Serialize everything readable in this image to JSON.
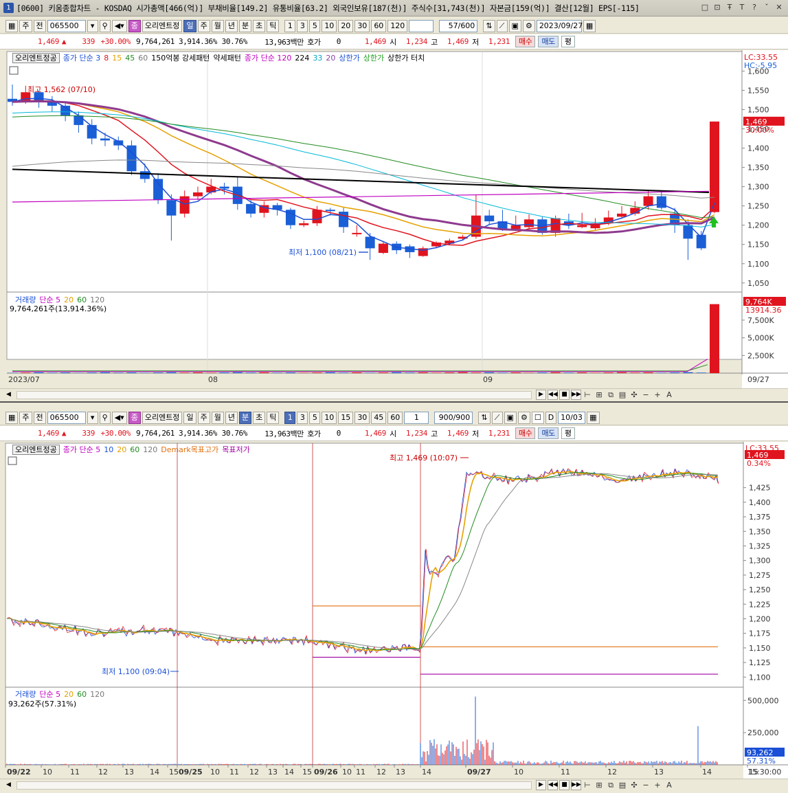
{
  "window": {
    "title": "[0600] 키움종합차트 - KOSDAQ 시가총액[466(억)] 부채비율[149.2] 유통비율[63.2] 외국인보유[187(천)] 주식수[31,743(천)] 자본금[159(억)] 결산[12월] EPS[-115]",
    "icon": "1",
    "buttons": [
      "□",
      "⊡",
      "Ŧ",
      "T",
      "?",
      "ˇ",
      "✕"
    ]
  },
  "daily": {
    "toolbar": {
      "type": "주",
      "prev": "전",
      "code": "065500",
      "search_icon": "magnifier",
      "jong_label": "종",
      "orient_label": "오리엔트정",
      "periods": [
        "일",
        "주",
        "월",
        "년",
        "분",
        "초",
        "틱"
      ],
      "numbers": [
        "1",
        "3",
        "5",
        "10",
        "20",
        "30",
        "60",
        "120"
      ],
      "count": "57/600",
      "date": "2023/09/27"
    },
    "quote": {
      "price": "1,469",
      "change": "339",
      "rate": "+30.00%",
      "volume": "9,764,261",
      "vol_rate": "3,914.36%",
      "turnover": "30.76%",
      "amount": "13,963백만",
      "hoga_label": "호가",
      "hoga_val": "0",
      "ask": "1,469",
      "open_label": "시",
      "open": "1,234",
      "high_label": "고",
      "high": "1,469",
      "low_label": "저",
      "low": "1,231",
      "buy": "매수",
      "sell": "매도",
      "pyeong": "평"
    },
    "legend": [
      "오리엔트정공",
      "종가 단순 3",
      "8",
      "15",
      "45",
      "60",
      "150억봉 강세패턴",
      "약세패턴",
      "종가 단순 120",
      "224",
      "33",
      "20",
      "상한가",
      "상한가",
      "상한가 터치"
    ],
    "price_axis": [
      "1,600",
      "1,550",
      "1,500",
      "1,450",
      "1,400",
      "1,350",
      "1,300",
      "1,250",
      "1,200",
      "1,150",
      "1,100",
      "1,050"
    ],
    "lc": "LC:33.55",
    "hc": "HC:-5.95",
    "current_tag": "1,469",
    "current_pct": "30.00%",
    "high_note": "최고 1,562 (07/10)",
    "low_note": "최저 1,100 (08/21)",
    "vol_legend": [
      "거래량",
      "단순 5",
      "20",
      "60",
      "120"
    ],
    "vol_info": "9,764,261주(13,914.36%)",
    "vol_axis": [
      "7,500K",
      "5,000K",
      "2,500K"
    ],
    "vol_tag": "9,764K",
    "vol_tag2": "13914.36",
    "date_axis": [
      "2023/07",
      "08",
      "09",
      "09/27"
    ]
  },
  "minute": {
    "toolbar": {
      "type": "주",
      "prev": "전",
      "code": "065500",
      "jong_label": "종",
      "orient_label": "오리엔트정",
      "periods": [
        "일",
        "주",
        "월",
        "년",
        "분",
        "초",
        "틱"
      ],
      "numbers": [
        "1",
        "3",
        "5",
        "10",
        "15",
        "30",
        "45",
        "60"
      ],
      "unit": "1",
      "count": "900/900",
      "d_label": "D",
      "date": "10/03"
    },
    "quote": {
      "price": "1,469",
      "change": "339",
      "rate": "+30.00%",
      "volume": "9,764,261",
      "vol_rate": "3,914.36%",
      "turnover": "30.76%",
      "amount": "13,963백만",
      "hoga_label": "호가",
      "hoga_val": "0",
      "ask": "1,469",
      "open_label": "시",
      "open": "1,234",
      "high_label": "고",
      "high": "1,469",
      "low_label": "저",
      "low": "1,231",
      "buy": "매수",
      "sell": "매도",
      "pyeong": "평"
    },
    "legend": [
      "오리엔트정공",
      "종가 단순 5",
      "10",
      "20",
      "60",
      "120",
      "Demark목표고가",
      "목표저가"
    ],
    "price_axis": [
      "1,425",
      "1,400",
      "1,375",
      "1,350",
      "1,325",
      "1,300",
      "1,275",
      "1,250",
      "1,225",
      "1,200",
      "1,175",
      "1,150",
      "1,125",
      "1,100"
    ],
    "lc": "LC:33.55",
    "current_tag": "1,469",
    "current_pct": "0.34%",
    "high_note": "최고 1,469 (10:07)",
    "low_note": "최저 1,100 (09:04)",
    "vol_legend": [
      "거래량",
      "단순 5",
      "20",
      "60",
      "120"
    ],
    "vol_info": "93,262주(57.31%)",
    "vol_axis": [
      "500,000",
      "250,000"
    ],
    "vol_tag": "93,262",
    "vol_tag2": "57.31%",
    "time_axis": [
      "09/22",
      "10",
      "11",
      "12",
      "13",
      "14",
      "15",
      "09/25",
      "10",
      "11",
      "12",
      "13",
      "14",
      "15",
      "09/26",
      "10",
      "11",
      "12",
      "13",
      "14",
      "09/27",
      "10",
      "11",
      "12",
      "13",
      "14",
      "15"
    ],
    "time_end": "15:30:00"
  },
  "colors": {
    "up": "#e0141e",
    "down": "#1a5fd6",
    "bg": "#ffffff",
    "grid": "#d8d8d8"
  }
}
